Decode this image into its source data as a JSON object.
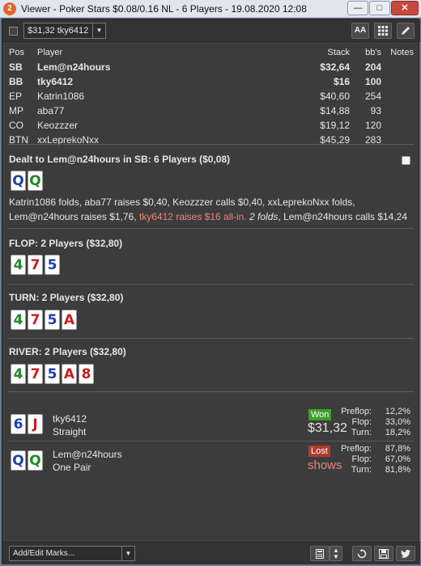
{
  "window": {
    "icon_text": "2",
    "title": "Viewer - Poker Stars $0.08/0.16 NL - 6 Players - 19.08.2020 12:08",
    "minimize": "—",
    "maximize": "□",
    "close": "✕"
  },
  "toolbar": {
    "select_value": "$31,32 tky6412",
    "font_btn": "AA",
    "grid_icon": "grid-icon",
    "edit_icon": "pencil-icon"
  },
  "players": {
    "headers": {
      "pos": "Pos",
      "player": "Player",
      "stack": "Stack",
      "bbs": "bb's",
      "notes": "Notes"
    },
    "rows": [
      {
        "pos": "SB",
        "player": "Lem@n24hours",
        "stack": "$32,64",
        "bbs": "204",
        "bold": true
      },
      {
        "pos": "BB",
        "player": "tky6412",
        "stack": "$16",
        "bbs": "100",
        "bold": true
      },
      {
        "pos": "EP",
        "player": "Katrin1086",
        "stack": "$40,60",
        "bbs": "254",
        "bold": false
      },
      {
        "pos": "MP",
        "player": "aba77",
        "stack": "$14,88",
        "bbs": "93",
        "bold": false
      },
      {
        "pos": "CO",
        "player": "Keozzzer",
        "stack": "$19,12",
        "bbs": "120",
        "bold": false
      },
      {
        "pos": "BTN",
        "player": "xxLeprekoNxx",
        "stack": "$45,29",
        "bbs": "283",
        "bold": false
      }
    ]
  },
  "preflop": {
    "title": "Dealt to Lem@n24hours in SB: 6 Players ($0,08)",
    "cards": [
      {
        "rank": "Q",
        "suit": "d"
      },
      {
        "rank": "Q",
        "suit": "c"
      }
    ],
    "line1": "Katrin1086 folds, aba77 raises $0,40, Keozzzer calls $0,40, xxLeprekoNxx folds,",
    "line2_a": "Lem@n24hours raises $1,76, ",
    "line2_hl": "tky6412 raises $16 all-in.",
    "line2_it": " 2 folds",
    "line2_b": ", Lem@n24hours calls $14,24"
  },
  "flop": {
    "title": "FLOP: 2 Players ($32,80)",
    "cards": [
      {
        "rank": "4",
        "suit": "c"
      },
      {
        "rank": "7",
        "suit": "h"
      },
      {
        "rank": "5",
        "suit": "d"
      }
    ]
  },
  "turn": {
    "title": "TURN: 2 Players ($32,80)",
    "cards": [
      {
        "rank": "4",
        "suit": "c"
      },
      {
        "rank": "7",
        "suit": "h"
      },
      {
        "rank": "5",
        "suit": "d"
      },
      {
        "rank": "A",
        "suit": "h"
      }
    ]
  },
  "river": {
    "title": "RIVER: 2 Players ($32,80)",
    "cards": [
      {
        "rank": "4",
        "suit": "c"
      },
      {
        "rank": "7",
        "suit": "h"
      },
      {
        "rank": "5",
        "suit": "d"
      },
      {
        "rank": "A",
        "suit": "h"
      },
      {
        "rank": "8",
        "suit": "h"
      }
    ]
  },
  "results": [
    {
      "player": "tky6412",
      "hand": "Straight",
      "cards": [
        {
          "rank": "6",
          "suit": "d"
        },
        {
          "rank": "J",
          "suit": "h"
        }
      ],
      "badge": "Won",
      "amount": "$31,32",
      "equity": [
        {
          "label": "Preflop:",
          "value": "12,2%"
        },
        {
          "label": "Flop:",
          "value": "33,0%"
        },
        {
          "label": "Turn:",
          "value": "18,2%"
        }
      ]
    },
    {
      "player": "Lem@n24hours",
      "hand": "One Pair",
      "cards": [
        {
          "rank": "Q",
          "suit": "d"
        },
        {
          "rank": "Q",
          "suit": "c"
        }
      ],
      "badge": "Lost",
      "amount": "shows",
      "equity": [
        {
          "label": "Preflop:",
          "value": "87,8%"
        },
        {
          "label": "Flop:",
          "value": "67,0%"
        },
        {
          "label": "Turn:",
          "value": "81,8%"
        }
      ]
    }
  ],
  "bottom": {
    "marks_placeholder": "Add/Edit Marks...",
    "calc_icon": "calculator-icon",
    "updown_icon": "up-down-icon",
    "replay_icon": "replay-icon",
    "save_icon": "save-icon",
    "twitter_icon": "twitter-icon"
  }
}
